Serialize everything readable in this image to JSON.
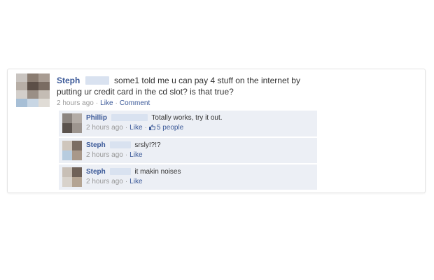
{
  "post": {
    "author": "Steph",
    "text_line1": "some1 told me u can pay 4 stuff on the internet by",
    "text_line2": "putting ur credit card in the cd slot? is that true?",
    "time": "2 hours ago",
    "like_label": "Like",
    "comment_label": "Comment"
  },
  "comments": [
    {
      "author": "Phillip",
      "text": "Totally works, try it out.",
      "time": "2 hours ago",
      "like_label": "Like",
      "likes": "5 people"
    },
    {
      "author": "Steph",
      "text": "srsly!?!?",
      "time": "2 hours ago",
      "like_label": "Like"
    },
    {
      "author": "Steph",
      "text": "it makin noises",
      "time": "2 hours ago",
      "like_label": "Like"
    }
  ],
  "icons": {
    "thumbs_up": "thumbs-up-icon",
    "avatar": "pixelated-avatar"
  },
  "colors": {
    "link": "#3b5998",
    "meta": "#999999",
    "comment_bg": "#eceff5",
    "blurred_name": "#d9e2f0"
  }
}
